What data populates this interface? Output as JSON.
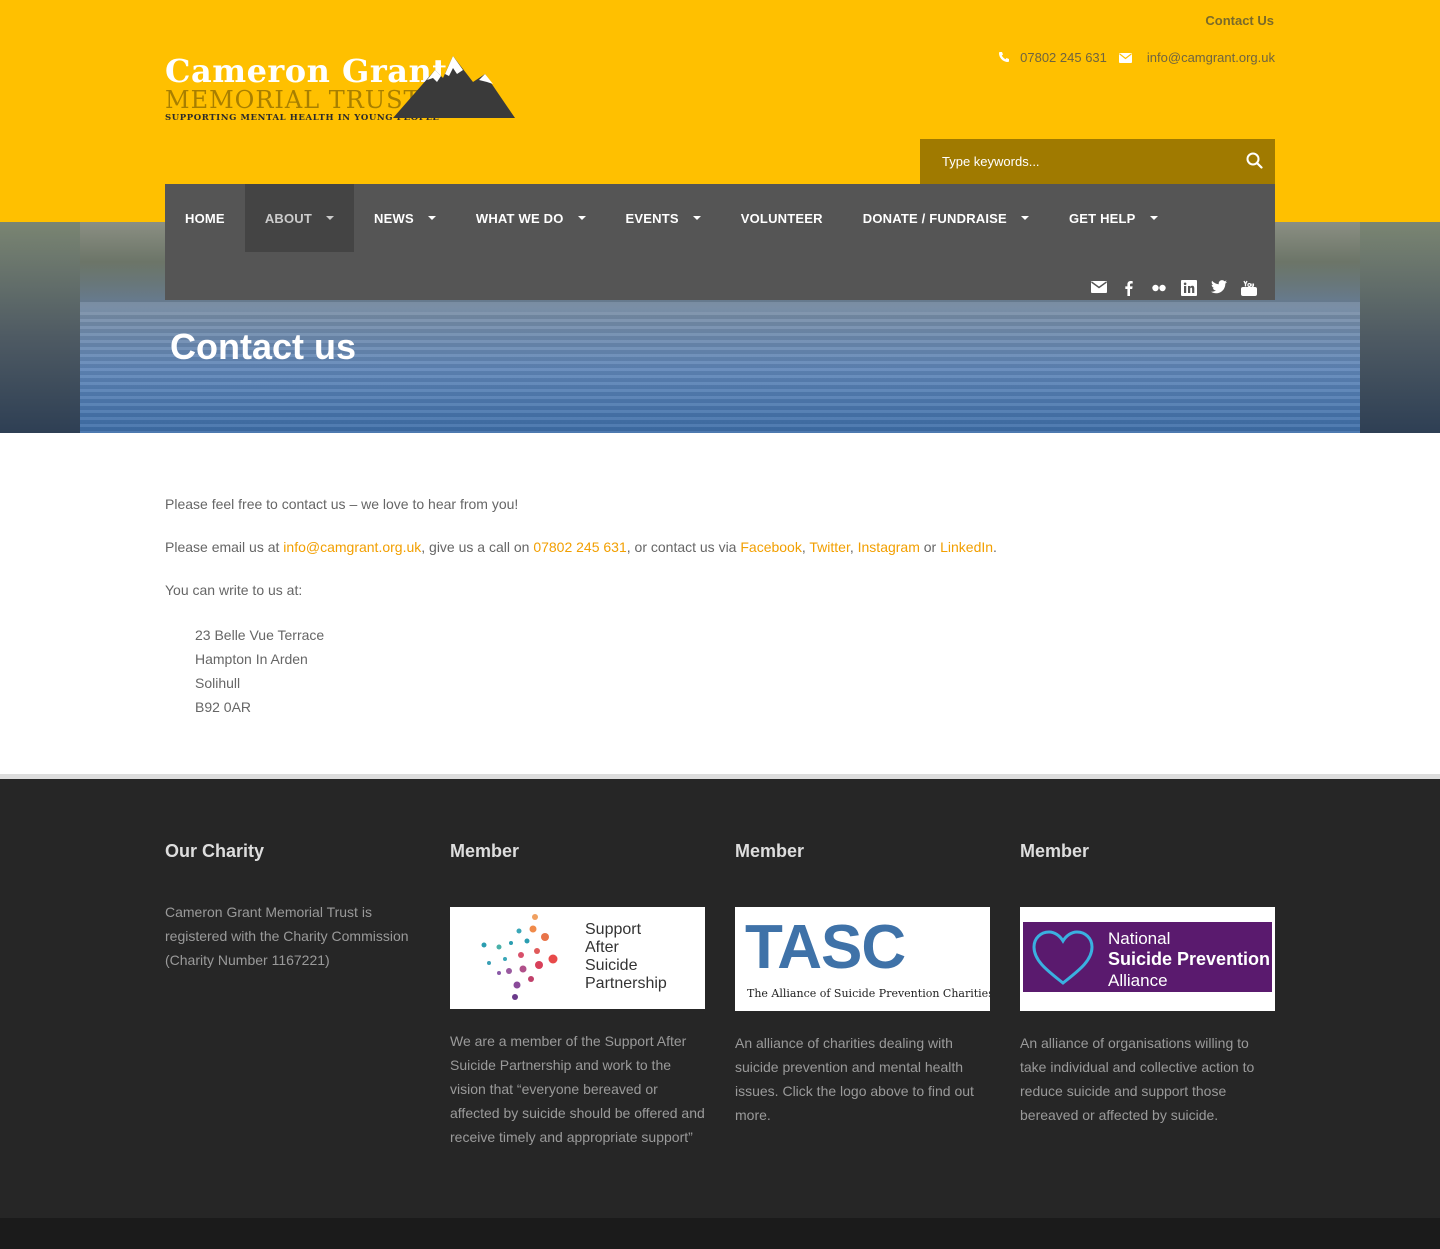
{
  "header": {
    "top_link": "Contact Us",
    "phone": "07802 245 631",
    "email": "info@camgrant.org.uk",
    "logo": {
      "line1": "Cameron Grant",
      "line2": "MEMORIAL TRUST",
      "tagline": "SUPPORTING MENTAL HEALTH IN YOUNG PEOPLE"
    },
    "search_placeholder": "Type keywords...",
    "accent": "#ffc000"
  },
  "nav": {
    "items": [
      {
        "label": "HOME",
        "dropdown": false,
        "active": false
      },
      {
        "label": "ABOUT",
        "dropdown": true,
        "active": true
      },
      {
        "label": "NEWS",
        "dropdown": true,
        "active": false
      },
      {
        "label": "WHAT WE DO",
        "dropdown": true,
        "active": false
      },
      {
        "label": "EVENTS",
        "dropdown": true,
        "active": false
      },
      {
        "label": "VOLUNTEER",
        "dropdown": false,
        "active": false
      },
      {
        "label": "DONATE / FUNDRAISE",
        "dropdown": true,
        "active": false
      },
      {
        "label": "GET HELP",
        "dropdown": true,
        "active": false
      }
    ],
    "social_icons": [
      "email-icon",
      "facebook-icon",
      "flickr-icon",
      "linkedin-icon",
      "twitter-icon",
      "youtube-icon"
    ]
  },
  "page": {
    "title": "Contact us",
    "intro": "Please feel free to contact us – we love to hear from you!",
    "email_prefix": "Please email us at ",
    "email_link": "info@camgrant.org.uk",
    "call_prefix": ", give us a call on ",
    "phone_link": "07802 245 631",
    "via_prefix": ", or contact us via ",
    "facebook": "Facebook",
    "comma1": ", ",
    "twitter": "Twitter",
    "comma2": ", ",
    "instagram": "Instagram",
    "or": " or ",
    "linkedin": "LinkedIn",
    "period": ".",
    "write_intro": "You can write to us at:",
    "address": [
      "23 Belle Vue Terrace",
      "Hampton In Arden",
      "Solihull",
      "B92 0AR"
    ],
    "link_color": "#f29f00"
  },
  "footer": {
    "columns": [
      {
        "heading": "Our Charity",
        "text": "Cameron Grant Memorial Trust is registered with the Charity Commission (Charity Number 1167221)"
      },
      {
        "heading": "Member",
        "logo_lines": [
          "Support",
          "After",
          "Suicide",
          "Partnership"
        ],
        "text": "We are a member of the Support After Suicide Partnership and work to the vision that “everyone bereaved or affected by suicide should be offered and receive timely and appropriate support”"
      },
      {
        "heading": "Member",
        "logo_title": "TASC",
        "logo_sub": "The Alliance of Suicide Prevention Charities",
        "text": "An alliance of charities dealing with suicide prevention and mental health issues. Click the logo above to find out more."
      },
      {
        "heading": "Member",
        "logo_lines": [
          "National",
          "Suicide Prevention",
          "Alliance"
        ],
        "text": "An alliance of organisations willing to take individual and collective action to reduce suicide and support those bereaved or affected by suicide."
      }
    ]
  }
}
